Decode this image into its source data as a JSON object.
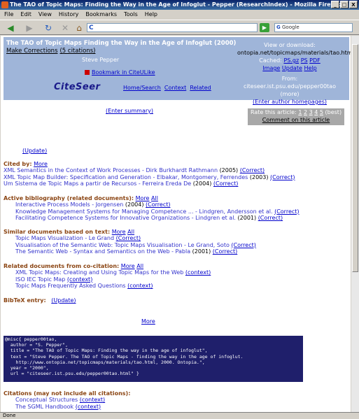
{
  "window": {
    "title": "The TAO of Topic Maps: Finding the Way in the Age of Infoglut - Pepper (ResearchIndex) - Mozilla Firefox",
    "buttons": [
      "_",
      "□",
      "X"
    ]
  },
  "menu": [
    "File",
    "Edit",
    "View",
    "History",
    "Bookmarks",
    "Tools",
    "Help"
  ],
  "toolbar": {
    "back": "◀",
    "forward": "▶",
    "reload": "↻",
    "stop": "✕",
    "home": "⌂",
    "url_value": "",
    "go_label": "▶",
    "search_value": "Google",
    "search_engine": "G"
  },
  "header": {
    "title": "The TAO of Topic Maps Finding the Way in the Age of Infoglut (2000)",
    "make_corrections": "Make Corrections",
    "citations_link": "(5 citations)",
    "subtitle": "Steve Pepper",
    "bookmark": "Bookmark in CiteULike",
    "logo": "CiteSeer",
    "home_search": "Home/Search",
    "context": "Context",
    "related": "Related",
    "view_download_label": "View or download:",
    "download_url": "ontopia.net/topicmaps/materials/tao.html",
    "cached_label": "Cached:",
    "cached_links": [
      "PS.gz",
      "PS",
      "PDF"
    ],
    "cached_links2": [
      "Image",
      "Update",
      "Help"
    ],
    "from_label": "From: citeseer.ist.psu.edu/pepper00tao (more)",
    "enter_author": "(Enter author homepages)"
  },
  "enter_summary": "(Enter summary)",
  "rating": {
    "label": "Rate this article:",
    "stars": [
      "1",
      "2",
      "3",
      "4",
      "5"
    ],
    "best": "(best)",
    "comment": "Comment on this article"
  },
  "update_link": "(Update)",
  "cited_by": {
    "heading": "Cited by:",
    "more": "More",
    "rows": [
      {
        "text": "XML Semantics in the Context of Work Processes - Dirk Burkhardt Rathmann",
        "year": "(2005)",
        "link": "(Correct)"
      },
      {
        "text": "XML Topic Map Builder: Specification and Generation - Elbakar, Montgomery, Ferrendes",
        "year": "(2003)",
        "link": "(Correct)"
      },
      {
        "text": "Um Sistema de Topic Maps a partir de Recursos - Ferreira Ereda De",
        "year": "(2004)",
        "link": "(Correct)"
      }
    ]
  },
  "active_bib": {
    "heading": "Active bibliography (related documents):",
    "more": "More",
    "all": "All",
    "rows": [
      {
        "text": "Interactive Process Models - Jorgensen",
        "year": "(2004)",
        "link": "(Correct)"
      },
      {
        "text": "Knowledge Management Systems for Managing Competence ... - Lindgren, Andersson et al.",
        "year": "",
        "link": "(Correct)"
      },
      {
        "text": "Facilitating Competence Systems for Innovative Organizations - Lindgren et al.",
        "year": "(2001)",
        "link": "(Correct)"
      }
    ]
  },
  "similar_docs": {
    "heading": "Similar documents based on text:",
    "more": "More",
    "all": "All",
    "rows": [
      {
        "text": "Topic Maps Visualization - Le Grand",
        "year": "",
        "link": "(Correct)"
      },
      {
        "text": "Visualisation of the Semantic Web: Topic Maps Visualisation - Le Grand, Soto",
        "year": "",
        "link": "(Correct)"
      },
      {
        "text": "The Semantic Web - Syntax and Semantics on the Web - Pabla",
        "year": "(2001)",
        "link": "(Correct)"
      }
    ]
  },
  "related_cocite": {
    "heading": "Related documents from co-citation:",
    "more": "More",
    "all": "All",
    "rows": [
      {
        "text": "XML Topic Maps: Creating and Using Topic Maps for the Web",
        "year": "",
        "link": "(context)"
      },
      {
        "text": "ISO IEC Topic Map",
        "year": "",
        "link": "(context)"
      },
      {
        "text": "Topic Maps Frequently Asked Questions",
        "year": "",
        "link": "(context)"
      }
    ]
  },
  "bibtex": {
    "heading": "BibTeX entry:",
    "update": "(Update)"
  },
  "more_center": "More",
  "bibtex_code": "@misc{ pepper00tao,\n  author = \"S. Pepper\",\n  title = \"The TAO of Topic Maps: Finding the way in the age of infoglut\",\n  text = \"Steve Pepper. The TAO of Topic Maps - finding the way in the age of infoglut.\n    http://www.ontopia.net/topicmaps/materials/tao.html, 2000. Ontopia.\",\n  year = \"2000\",\n  url = \"citeseer.ist.psu.edu/pepper00tao.html\" }",
  "citations_section": {
    "heading": "Citations (may not include all citations):",
    "rows": [
      {
        "text": "Conceptual Structures",
        "link": "(context)"
      },
      {
        "text": "The SGML Handbook",
        "link": "(context)"
      }
    ]
  },
  "status": "Done"
}
